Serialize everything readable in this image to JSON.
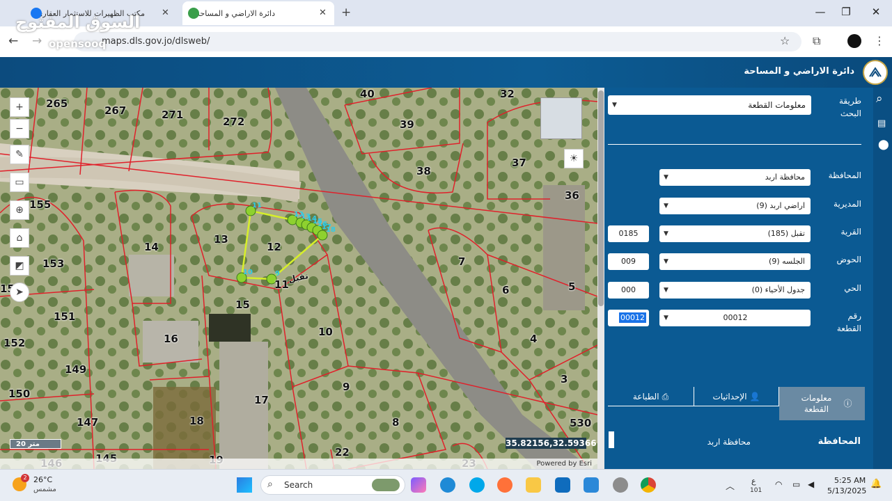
{
  "browser": {
    "tabs": [
      {
        "title": "مكتب الظهيرات للاستثمار العقاري"
      },
      {
        "title": "دائرة الاراضي و المساحة"
      }
    ],
    "url": "maps.dls.gov.jo/dlsweb/",
    "watermark": "السوق المفتوح",
    "watermark_sub": "opensooq"
  },
  "header": {
    "title": "دائرة الاراضي و المساحة"
  },
  "panel": {
    "search_method_label": "طريقة البحث",
    "search_method_value": "معلومات القطعة",
    "fields": [
      {
        "label": "المحافظة",
        "value": "محافظة اربد",
        "code": ""
      },
      {
        "label": "المديرية",
        "value": "اراضي اربد (9)",
        "code": ""
      },
      {
        "label": "القرية",
        "value": "تقبل (185)",
        "code": "0185"
      },
      {
        "label": "الحوض",
        "value": "الجلسه (9)",
        "code": "009"
      },
      {
        "label": "الحي",
        "value": "جدول الأحياء (0)",
        "code": "000"
      },
      {
        "label": "رقم القطعة",
        "value": "00012",
        "code": "00012"
      }
    ],
    "tabs": [
      "معلومات القطعة",
      "الإحداثيات",
      "الطباعة"
    ],
    "result_label": "المحافظة",
    "result_value": "محافظة اربد"
  },
  "map": {
    "scale": "20 متر",
    "coords": "35.82156,32.59366",
    "powered": "Powered by Esri",
    "village_label": "تقبل",
    "plots": [
      "265",
      "267",
      "271",
      "272",
      "40",
      "32",
      "39",
      "38",
      "37",
      "36",
      "155",
      "14",
      "13",
      "12",
      "153",
      "7",
      "6",
      "5",
      "15",
      "11",
      "10",
      "151",
      "16",
      "152",
      "149",
      "9",
      "4",
      "3",
      "150",
      "17",
      "18",
      "147",
      "8",
      "530",
      "146",
      "145",
      "19",
      "22",
      "23",
      "15"
    ],
    "vertices": [
      "11",
      "10",
      "9",
      "12",
      "13",
      "14",
      "15",
      "16",
      "17",
      "18"
    ]
  },
  "taskbar": {
    "weather_temp": "26°C",
    "weather_desc": "مشمس",
    "weather_badge": "2",
    "search_placeholder": "Search",
    "time": "5:25 AM",
    "date": "5/13/2025",
    "lang": "ع",
    "lang_sub": "101"
  },
  "colors": {
    "header": "#0c4b7e",
    "panel": "#0b5a93",
    "parcel": "#e0202a",
    "selected": "#d7ef2a",
    "active_tab": "#6a8aa3"
  }
}
